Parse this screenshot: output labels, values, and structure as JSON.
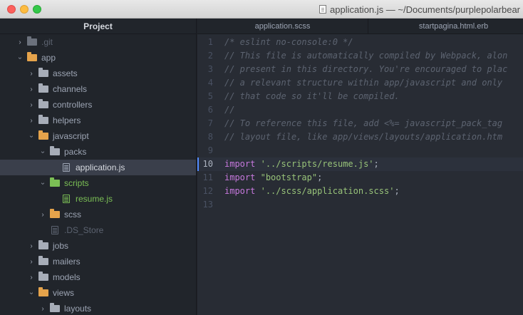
{
  "window": {
    "title": "application.js — ~/Documents/purplepolarbear",
    "colors": {
      "close": "#fc605c",
      "minimize": "#fdbc40",
      "maximize": "#34c84a"
    }
  },
  "sidebar": {
    "header": "Project",
    "items": [
      {
        "label": ".git",
        "type": "folder",
        "expanded": false,
        "depth": 0,
        "color": "dim",
        "text": "dim"
      },
      {
        "label": "app",
        "type": "folder",
        "expanded": true,
        "depth": 0,
        "color": "orange"
      },
      {
        "label": "assets",
        "type": "folder",
        "expanded": false,
        "depth": 1,
        "color": "gray"
      },
      {
        "label": "channels",
        "type": "folder",
        "expanded": false,
        "depth": 1,
        "color": "gray"
      },
      {
        "label": "controllers",
        "type": "folder",
        "expanded": false,
        "depth": 1,
        "color": "gray"
      },
      {
        "label": "helpers",
        "type": "folder",
        "expanded": false,
        "depth": 1,
        "color": "gray"
      },
      {
        "label": "javascript",
        "type": "folder",
        "expanded": true,
        "depth": 1,
        "color": "orange"
      },
      {
        "label": "packs",
        "type": "folder",
        "expanded": true,
        "depth": 2,
        "color": "gray"
      },
      {
        "label": "application.js",
        "type": "file",
        "depth": 3,
        "selected": true
      },
      {
        "label": "scripts",
        "type": "folder",
        "expanded": true,
        "depth": 2,
        "color": "green",
        "text": "green"
      },
      {
        "label": "resume.js",
        "type": "file",
        "depth": 3,
        "color": "green",
        "text": "green"
      },
      {
        "label": "scss",
        "type": "folder",
        "expanded": false,
        "depth": 2,
        "color": "orange"
      },
      {
        "label": ".DS_Store",
        "type": "file",
        "depth": 2,
        "color": "dim",
        "text": "dim"
      },
      {
        "label": "jobs",
        "type": "folder",
        "expanded": false,
        "depth": 1,
        "color": "gray"
      },
      {
        "label": "mailers",
        "type": "folder",
        "expanded": false,
        "depth": 1,
        "color": "gray"
      },
      {
        "label": "models",
        "type": "folder",
        "expanded": false,
        "depth": 1,
        "color": "gray"
      },
      {
        "label": "views",
        "type": "folder",
        "expanded": true,
        "depth": 1,
        "color": "orange"
      },
      {
        "label": "layouts",
        "type": "folder",
        "expanded": false,
        "depth": 2,
        "color": "gray"
      }
    ]
  },
  "tabs": [
    {
      "label": "application.scss",
      "active": false
    },
    {
      "label": "startpagina.html.erb",
      "active": false
    }
  ],
  "editor": {
    "current_line": 10,
    "lines": [
      {
        "n": "1",
        "tokens": [
          {
            "t": "comment",
            "v": "/* eslint no-console:0 */"
          }
        ]
      },
      {
        "n": "2",
        "tokens": [
          {
            "t": "comment",
            "v": "// This file is automatically compiled by Webpack, alon"
          }
        ]
      },
      {
        "n": "3",
        "tokens": [
          {
            "t": "comment",
            "v": "// present in this directory. You're encouraged to plac"
          }
        ]
      },
      {
        "n": "4",
        "tokens": [
          {
            "t": "comment",
            "v": "// a relevant structure within app/javascript and only"
          }
        ]
      },
      {
        "n": "5",
        "tokens": [
          {
            "t": "comment",
            "v": "// that code so it'll be compiled."
          }
        ]
      },
      {
        "n": "6",
        "tokens": [
          {
            "t": "comment",
            "v": "//"
          }
        ]
      },
      {
        "n": "7",
        "tokens": [
          {
            "t": "comment",
            "v": "// To reference this file, add <%= javascript_pack_tag"
          }
        ]
      },
      {
        "n": "8",
        "tokens": [
          {
            "t": "comment",
            "v": "// layout file, like app/views/layouts/application.htm"
          }
        ]
      },
      {
        "n": "9",
        "tokens": []
      },
      {
        "n": "10",
        "tokens": [
          {
            "t": "kw",
            "v": "import"
          },
          {
            "t": "punct",
            "v": " "
          },
          {
            "t": "str",
            "v": "'../scripts/resume.js'"
          },
          {
            "t": "punct",
            "v": ";"
          }
        ]
      },
      {
        "n": "11",
        "tokens": [
          {
            "t": "kw",
            "v": "import"
          },
          {
            "t": "punct",
            "v": " "
          },
          {
            "t": "str",
            "v": "\"bootstrap\""
          },
          {
            "t": "punct",
            "v": ";"
          }
        ]
      },
      {
        "n": "12",
        "tokens": [
          {
            "t": "kw",
            "v": "import"
          },
          {
            "t": "punct",
            "v": " "
          },
          {
            "t": "str",
            "v": "'../scss/application.scss'"
          },
          {
            "t": "punct",
            "v": ";"
          }
        ]
      },
      {
        "n": "13",
        "tokens": []
      }
    ]
  }
}
